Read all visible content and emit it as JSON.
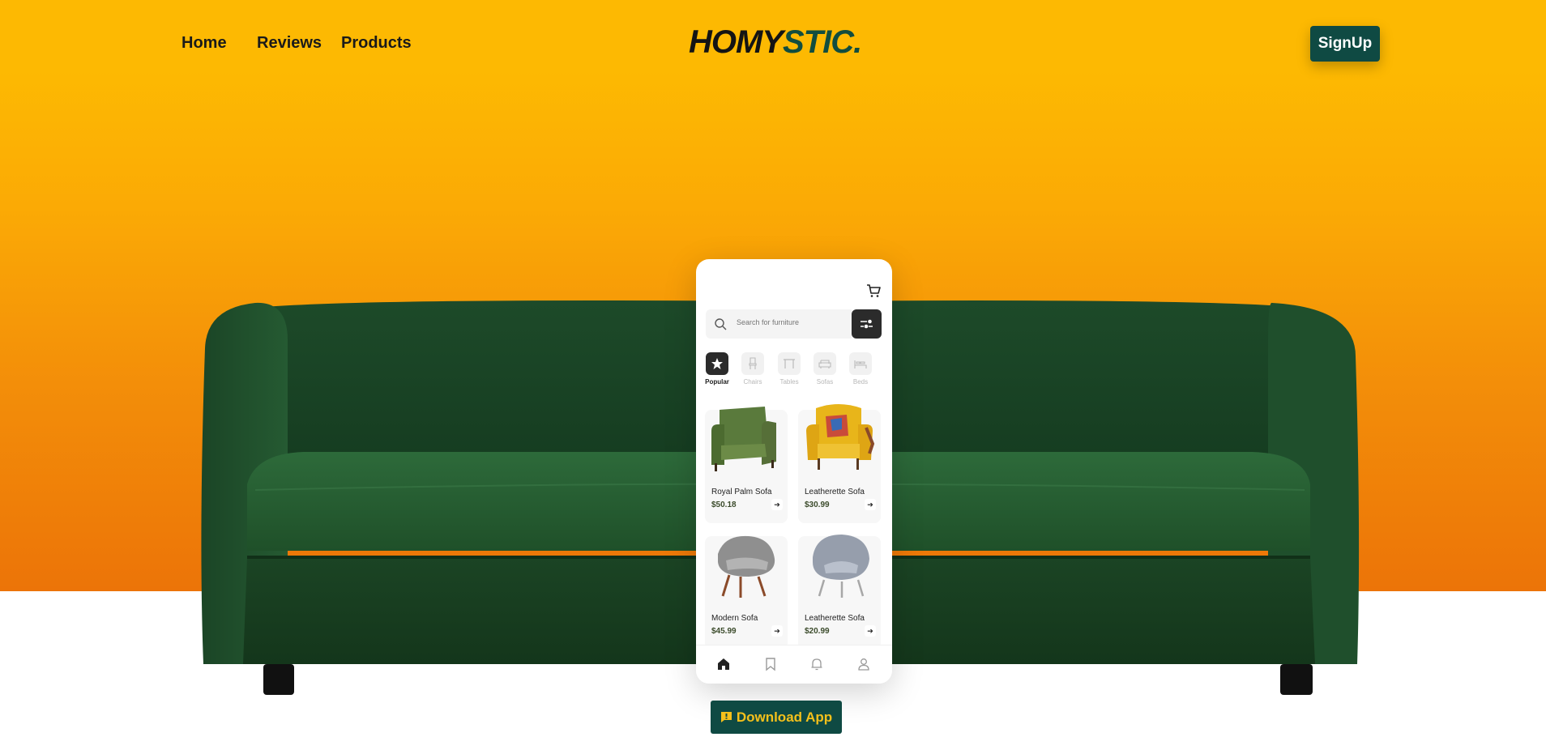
{
  "nav": {
    "links": [
      "Home",
      "Reviews",
      "Products"
    ],
    "logo_part1": "HOMY",
    "logo_part2": "STIC.",
    "signup_label": "SignUp"
  },
  "colors": {
    "hero_top": "#fdb902",
    "hero_bottom": "#ec7408",
    "brand_dark": "#0f4a43",
    "logo_green": "#114d3f",
    "sofa_green": "#1f4a2a",
    "download_text": "#f4c01b"
  },
  "phone": {
    "cart_icon": "cart-icon",
    "search_placeholder": "Search for furniture",
    "filter_icon": "filter-icon",
    "categories": [
      {
        "label": "Popular",
        "icon": "star-icon",
        "active": true
      },
      {
        "label": "Chairs",
        "icon": "chair-icon",
        "active": false
      },
      {
        "label": "Tables",
        "icon": "table-icon",
        "active": false
      },
      {
        "label": "Sofas",
        "icon": "sofa-icon",
        "active": false
      },
      {
        "label": "Beds",
        "icon": "bed-icon",
        "active": false
      }
    ],
    "products": [
      {
        "name": "Royal Palm Sofa",
        "price": "$50.18",
        "color": "#4e6a34"
      },
      {
        "name": "Leatherette Sofa",
        "price": "$30.99",
        "color": "#e4b21a"
      },
      {
        "name": "Modern Sofa",
        "price": "$45.99",
        "color": "#9a9a9a"
      },
      {
        "name": "Leatherette Sofa",
        "price": "$20.99",
        "color": "#9ea6b4"
      }
    ],
    "bottom_nav": [
      "home-icon",
      "bookmark-icon",
      "bell-icon",
      "user-icon"
    ]
  },
  "download": {
    "label": "Download App",
    "icon": "chat-icon"
  }
}
